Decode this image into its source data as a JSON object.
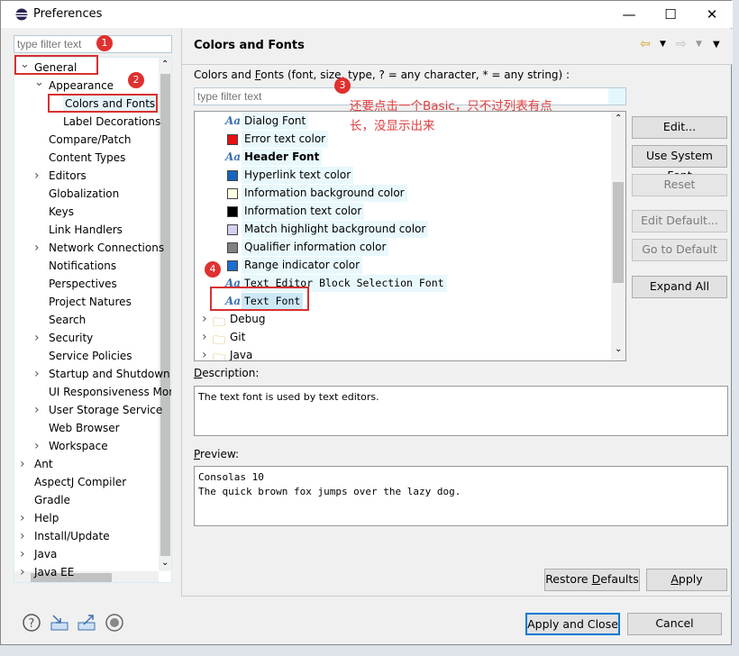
{
  "window": {
    "title": "Preferences",
    "minimize": "—",
    "maximize": "☐",
    "close": "✕"
  },
  "left": {
    "filter_placeholder": "type filter text",
    "tree": [
      {
        "label": "General",
        "level": 0,
        "state": "open"
      },
      {
        "label": "Appearance",
        "level": 1,
        "state": "open"
      },
      {
        "label": "Colors and Fonts",
        "level": 2,
        "state": "leaf",
        "selected": true
      },
      {
        "label": "Label Decorations",
        "level": 2,
        "state": "leaf"
      },
      {
        "label": "Compare/Patch",
        "level": 1,
        "state": "leaf"
      },
      {
        "label": "Content Types",
        "level": 1,
        "state": "leaf"
      },
      {
        "label": "Editors",
        "level": 1,
        "state": "closed"
      },
      {
        "label": "Globalization",
        "level": 1,
        "state": "leaf"
      },
      {
        "label": "Keys",
        "level": 1,
        "state": "leaf"
      },
      {
        "label": "Link Handlers",
        "level": 1,
        "state": "leaf"
      },
      {
        "label": "Network Connections",
        "level": 1,
        "state": "closed"
      },
      {
        "label": "Notifications",
        "level": 1,
        "state": "leaf"
      },
      {
        "label": "Perspectives",
        "level": 1,
        "state": "leaf"
      },
      {
        "label": "Project Natures",
        "level": 1,
        "state": "leaf"
      },
      {
        "label": "Search",
        "level": 1,
        "state": "leaf"
      },
      {
        "label": "Security",
        "level": 1,
        "state": "closed"
      },
      {
        "label": "Service Policies",
        "level": 1,
        "state": "leaf"
      },
      {
        "label": "Startup and Shutdown",
        "level": 1,
        "state": "closed"
      },
      {
        "label": "UI Responsiveness Monitoring",
        "level": 1,
        "state": "leaf"
      },
      {
        "label": "User Storage Service",
        "level": 1,
        "state": "closed"
      },
      {
        "label": "Web Browser",
        "level": 1,
        "state": "leaf"
      },
      {
        "label": "Workspace",
        "level": 1,
        "state": "closed"
      },
      {
        "label": "Ant",
        "level": 0,
        "state": "closed"
      },
      {
        "label": "AspectJ Compiler",
        "level": 0,
        "state": "leaf"
      },
      {
        "label": "Gradle",
        "level": 0,
        "state": "leaf"
      },
      {
        "label": "Help",
        "level": 0,
        "state": "closed"
      },
      {
        "label": "Install/Update",
        "level": 0,
        "state": "closed"
      },
      {
        "label": "Java",
        "level": 0,
        "state": "closed"
      },
      {
        "label": "Java EE",
        "level": 0,
        "state": "closed"
      }
    ]
  },
  "page": {
    "title": "Colors and Fonts",
    "filter_label": "Colors and Fonts (font, size, type, ? = any character, * = any string) :",
    "filter_mnemonic": 11,
    "filter_placeholder": "type filter text",
    "items": [
      {
        "label": "Dialog Font",
        "kind": "font"
      },
      {
        "label": "Error text color",
        "kind": "color",
        "color": "#e81010"
      },
      {
        "label": "Header Font",
        "kind": "font",
        "bold": true
      },
      {
        "label": "Hyperlink text color",
        "kind": "color",
        "color": "#1565c0"
      },
      {
        "label": "Information background color",
        "kind": "color",
        "color": "#ffffe1"
      },
      {
        "label": "Information text color",
        "kind": "color",
        "color": "#000000"
      },
      {
        "label": "Match highlight background color",
        "kind": "color",
        "color": "#d4d0f0"
      },
      {
        "label": "Qualifier information color",
        "kind": "color",
        "color": "#808080"
      },
      {
        "label": "Range indicator color",
        "kind": "color",
        "color": "#1a6fd0"
      },
      {
        "label": "Text Editor Block Selection Font",
        "kind": "font",
        "mono": true
      },
      {
        "label": "Text Font",
        "kind": "font",
        "mono": true,
        "selected": true
      },
      {
        "label": "Debug",
        "kind": "category"
      },
      {
        "label": "Git",
        "kind": "category"
      },
      {
        "label": "Java",
        "kind": "category"
      }
    ],
    "buttons": [
      {
        "label": "Edit...",
        "mn": 0,
        "enabled": true
      },
      {
        "label": "Use System Font",
        "mn": 0,
        "enabled": true
      },
      {
        "label": "Reset",
        "mn": 0,
        "enabled": false
      },
      {
        "label": "Edit Default...",
        "mn": 2,
        "enabled": false
      },
      {
        "label": "Go to Default",
        "mn": 0,
        "enabled": false
      },
      {
        "label": "Expand All",
        "mn": 1,
        "enabled": true
      }
    ],
    "description_label": "Description:",
    "description": "The text font is used by text editors.",
    "preview_label": "Preview:",
    "preview": "Consolas 10\nThe quick brown fox jumps over the lazy dog.",
    "restore_defaults": "Restore Defaults",
    "apply": "Apply"
  },
  "footer": {
    "apply_close": "Apply and Close",
    "cancel": "Cancel",
    "icons": [
      "help-icon",
      "import-icon",
      "export-icon",
      "record-icon"
    ]
  },
  "annotations": {
    "badges": [
      "1",
      "2",
      "3",
      "4"
    ],
    "note": "还要点击一个Basic，只不过列表有点长，没显示出来"
  }
}
